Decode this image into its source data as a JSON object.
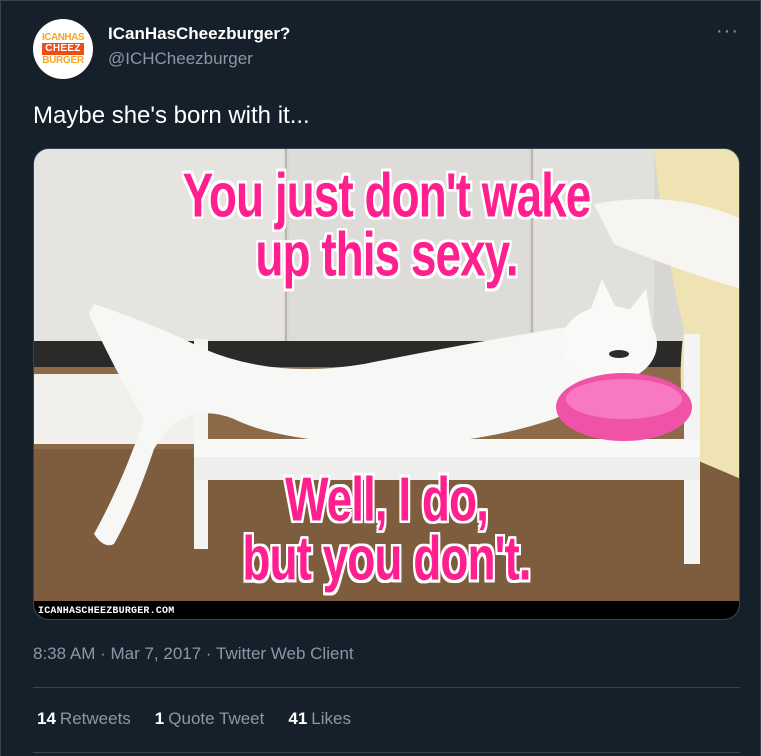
{
  "author": {
    "display_name": "ICanHasCheezburger?",
    "handle": "@ICHCheezburger",
    "avatar_text": [
      "ICANHAS",
      "CHEEZ",
      "BURGER"
    ]
  },
  "tweet": {
    "text": "Maybe she's born with it...",
    "timestamp": "8:38 AM · Mar 7, 2017 · Twitter Web Client"
  },
  "media": {
    "caption_top": [
      "You just don't wake",
      "up this sexy."
    ],
    "caption_bottom": [
      "Well, I do,",
      "but you don't."
    ],
    "watermark": "ICANHASCHEEZBURGER.COM"
  },
  "stats": {
    "retweets_count": "14",
    "retweets_label": "Retweets",
    "quotes_count": "1",
    "quotes_label": "Quote Tweet",
    "likes_count": "41",
    "likes_label": "Likes"
  },
  "more_icon": "more-dots-icon",
  "colors": {
    "background": "#15202b",
    "secondary_text": "#8899a6",
    "divider": "#38444d",
    "meme_pink": "#ff1f8e"
  }
}
